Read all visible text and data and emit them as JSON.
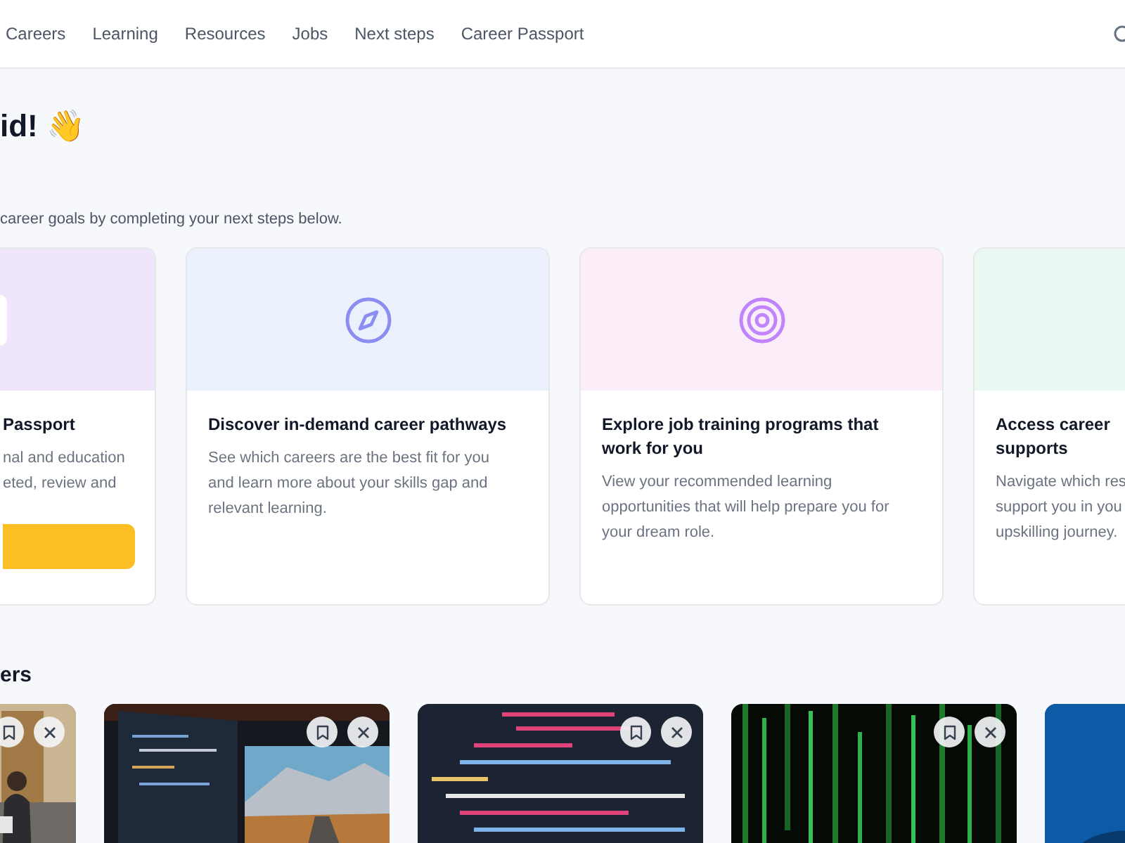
{
  "nav": {
    "links": [
      {
        "label": "Careers"
      },
      {
        "label": "Learning"
      },
      {
        "label": "Resources"
      },
      {
        "label": "Jobs"
      },
      {
        "label": "Next steps"
      },
      {
        "label": "Career Passport"
      }
    ]
  },
  "greeting": "id! 👋",
  "subtitle": "career goals by completing your next steps below.",
  "cards": [
    {
      "color": "#efe6fb",
      "title_lines": [
        "Passport"
      ],
      "desc_lines": [
        "nal and education",
        "eted, review and"
      ],
      "action_button": true
    },
    {
      "color": "#eaf0fc",
      "title_lines": [
        "Discover in-demand career pathways"
      ],
      "desc_lines": [
        "See which careers are the best fit for you and learn more about your skills gap and relevant learning."
      ],
      "action_button": false
    },
    {
      "color": "#fbeef8",
      "title_lines": [
        "Explore job training programs that work for you"
      ],
      "desc_lines": [
        "View your recommended learning opportunities that will help prepare you for your dream role."
      ],
      "action_button": false
    },
    {
      "color": "#e9f9f1",
      "title_lines": [
        "Access career",
        "supports"
      ],
      "desc_lines": [
        "Navigate which res",
        "support you in you",
        "upskilling journey."
      ],
      "action_button": false
    }
  ],
  "section_title": "ers",
  "pictures": [
    {
      "kind": "picture",
      "actions": true
    },
    {
      "kind": "picture",
      "actions": true
    },
    {
      "kind": "picture",
      "actions": true
    },
    {
      "kind": "picture",
      "actions": true
    },
    {
      "kind": "picture",
      "actions": false
    }
  ]
}
